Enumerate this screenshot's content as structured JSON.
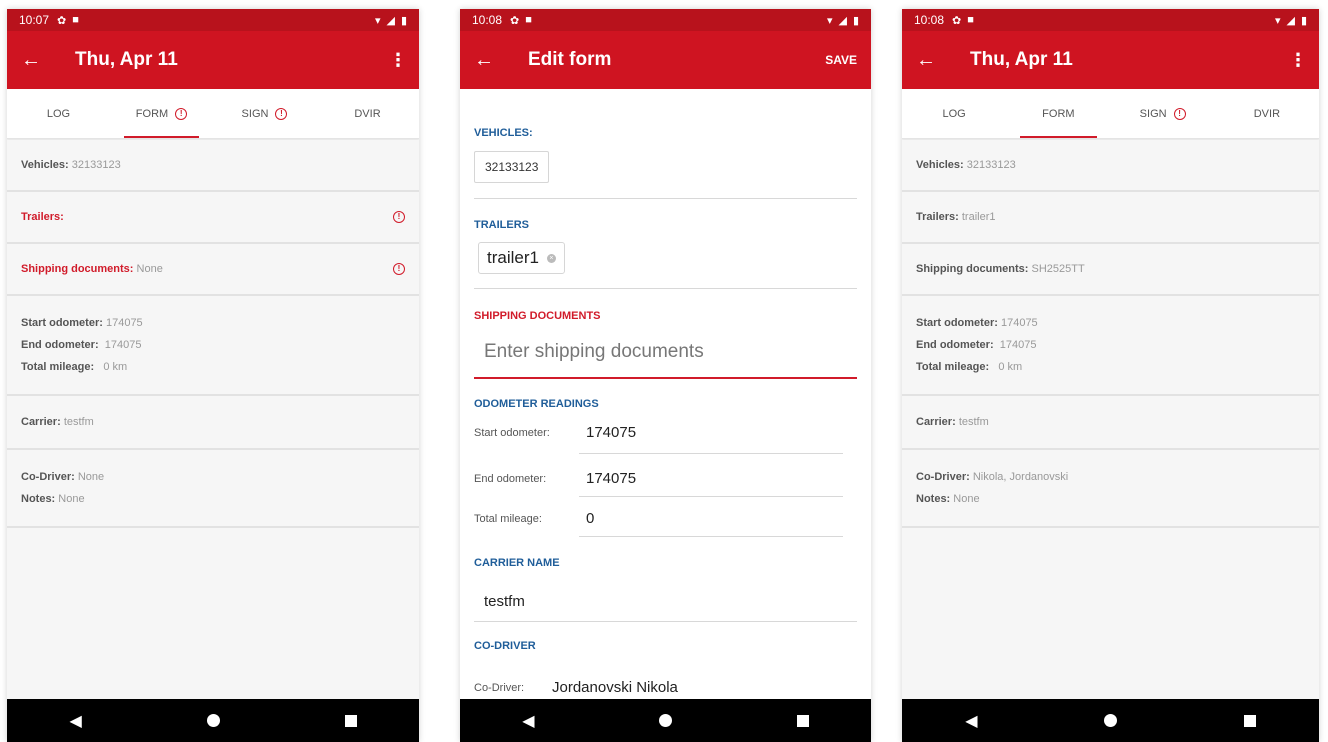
{
  "screen1": {
    "status": {
      "time": "10:07"
    },
    "appbar": {
      "title": "Thu, Apr 11",
      "back_icon": "arrow-left-icon",
      "more_icon": "more-vert-icon"
    },
    "tabs": [
      {
        "label": "LOG",
        "alert": false
      },
      {
        "label": "FORM",
        "alert": true,
        "active": true
      },
      {
        "label": "SIGN",
        "alert": true
      },
      {
        "label": "DVIR",
        "alert": false
      }
    ],
    "vehicles_label": "Vehicles:",
    "vehicles_value": "32133123",
    "trailers_label": "Trailers:",
    "trailers_value": "",
    "shipping_label": "Shipping documents:",
    "shipping_value": "None",
    "start_odo_label": "Start odometer:",
    "start_odo_value": "174075",
    "end_odo_label": "End odometer:",
    "end_odo_value": "174075",
    "total_mileage_label": "Total mileage:",
    "total_mileage_value": "0 km",
    "carrier_label": "Carrier:",
    "carrier_value": "testfm",
    "codriver_label": "Co-Driver:",
    "codriver_value": "None",
    "notes_label": "Notes:",
    "notes_value": "None"
  },
  "screen2": {
    "status": {
      "time": "10:08"
    },
    "appbar": {
      "title": "Edit form",
      "save_label": "SAVE",
      "back_icon": "arrow-left-icon"
    },
    "vehicles_header": "VEHICLES:",
    "vehicles_chip": "32133123",
    "trailers_header": "TRAILERS",
    "trailer_chip": "trailer1",
    "shipping_header": "SHIPPING DOCUMENTS",
    "shipping_placeholder": "Enter shipping documents",
    "odometer_header": "ODOMETER READINGS",
    "start_odo_label": "Start odometer:",
    "start_odo_value": "174075",
    "end_odo_label": "End odometer:",
    "end_odo_value": "174075",
    "total_mileage_label": "Total mileage:",
    "total_mileage_value": "0",
    "carrier_header": "CARRIER NAME",
    "carrier_value": "testfm",
    "codriver_header": "CO-DRIVER",
    "codriver_label": "Co-Driver:",
    "codriver_value": "Jordanovski Nikola"
  },
  "screen3": {
    "status": {
      "time": "10:08"
    },
    "appbar": {
      "title": "Thu, Apr 11",
      "back_icon": "arrow-left-icon",
      "more_icon": "more-vert-icon"
    },
    "tabs": [
      {
        "label": "LOG",
        "alert": false
      },
      {
        "label": "FORM",
        "alert": false,
        "active": true
      },
      {
        "label": "SIGN",
        "alert": true
      },
      {
        "label": "DVIR",
        "alert": false
      }
    ],
    "vehicles_label": "Vehicles:",
    "vehicles_value": "32133123",
    "trailers_label": "Trailers:",
    "trailers_value": "trailer1",
    "shipping_label": "Shipping documents:",
    "shipping_value": "SH2525TT",
    "start_odo_label": "Start odometer:",
    "start_odo_value": "174075",
    "end_odo_label": "End odometer:",
    "end_odo_value": "174075",
    "total_mileage_label": "Total mileage:",
    "total_mileage_value": "0 km",
    "carrier_label": "Carrier:",
    "carrier_value": "testfm",
    "codriver_label": "Co-Driver:",
    "codriver_value": "Nikola, Jordanovski",
    "notes_label": "Notes:",
    "notes_value": "None"
  },
  "theme": {
    "primary": "#cf1421",
    "status_bar": "#b8121c",
    "error": "#d11b2a",
    "section_header": "#1f5d99"
  },
  "system_nav": {
    "back_icon": "nav-back-icon",
    "home_icon": "nav-home-icon",
    "recents_icon": "nav-recents-icon"
  }
}
